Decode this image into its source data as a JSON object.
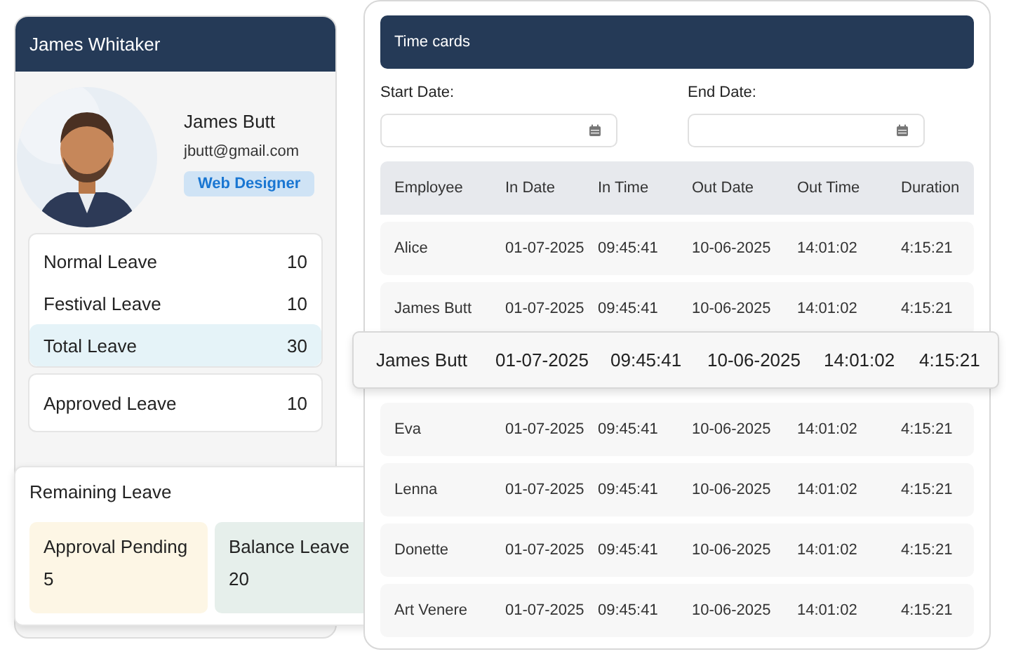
{
  "profile_card": {
    "title": "James Whitaker",
    "name": "James Butt",
    "email": "jbutt@gmail.com",
    "role": "Web Designer",
    "leave_groups": [
      {
        "items": [
          {
            "label": "Normal Leave",
            "value": "10",
            "highlighted": false
          },
          {
            "label": "Festival Leave",
            "value": "10",
            "highlighted": false
          },
          {
            "label": "Total Leave",
            "value": "30",
            "highlighted": true
          }
        ]
      },
      {
        "items": [
          {
            "label": "Approved Leave",
            "value": "10",
            "highlighted": false
          }
        ]
      }
    ]
  },
  "remaining_leave": {
    "title": "Remaining Leave",
    "tiles": [
      {
        "label": "Approval Pending",
        "value": "5",
        "color": "#fdf6e5"
      },
      {
        "label": "Balance Leave",
        "value": "20",
        "color": "#e6efeb"
      }
    ]
  },
  "time_cards": {
    "title": "Time cards",
    "start_date": {
      "label": "Start Date:"
    },
    "end_date": {
      "label": "End Date:"
    },
    "columns": [
      "Employee",
      "In Date",
      "In Time",
      "Out Date",
      "Out Time",
      "Duration"
    ],
    "rows": [
      [
        "Alice",
        "01-07-2025",
        "09:45:41",
        "10-06-2025",
        "14:01:02",
        "4:15:21"
      ],
      [
        "James Butt",
        "01-07-2025",
        "09:45:41",
        "10-06-2025",
        "14:01:02",
        "4:15:21"
      ],
      null,
      [
        "Eva",
        "01-07-2025",
        "09:45:41",
        "10-06-2025",
        "14:01:02",
        "4:15:21"
      ],
      [
        "Lenna",
        "01-07-2025",
        "09:45:41",
        "10-06-2025",
        "14:01:02",
        "4:15:21"
      ],
      [
        "Donette",
        "01-07-2025",
        "09:45:41",
        "10-06-2025",
        "14:01:02",
        "4:15:21"
      ],
      [
        "Art Venere",
        "01-07-2025",
        "09:45:41",
        "10-06-2025",
        "14:01:02",
        "4:15:21"
      ]
    ],
    "hovered_row": [
      "James Butt",
      "01-07-2025",
      "09:45:41",
      "10-06-2025",
      "14:01:02",
      "4:15:21"
    ]
  }
}
